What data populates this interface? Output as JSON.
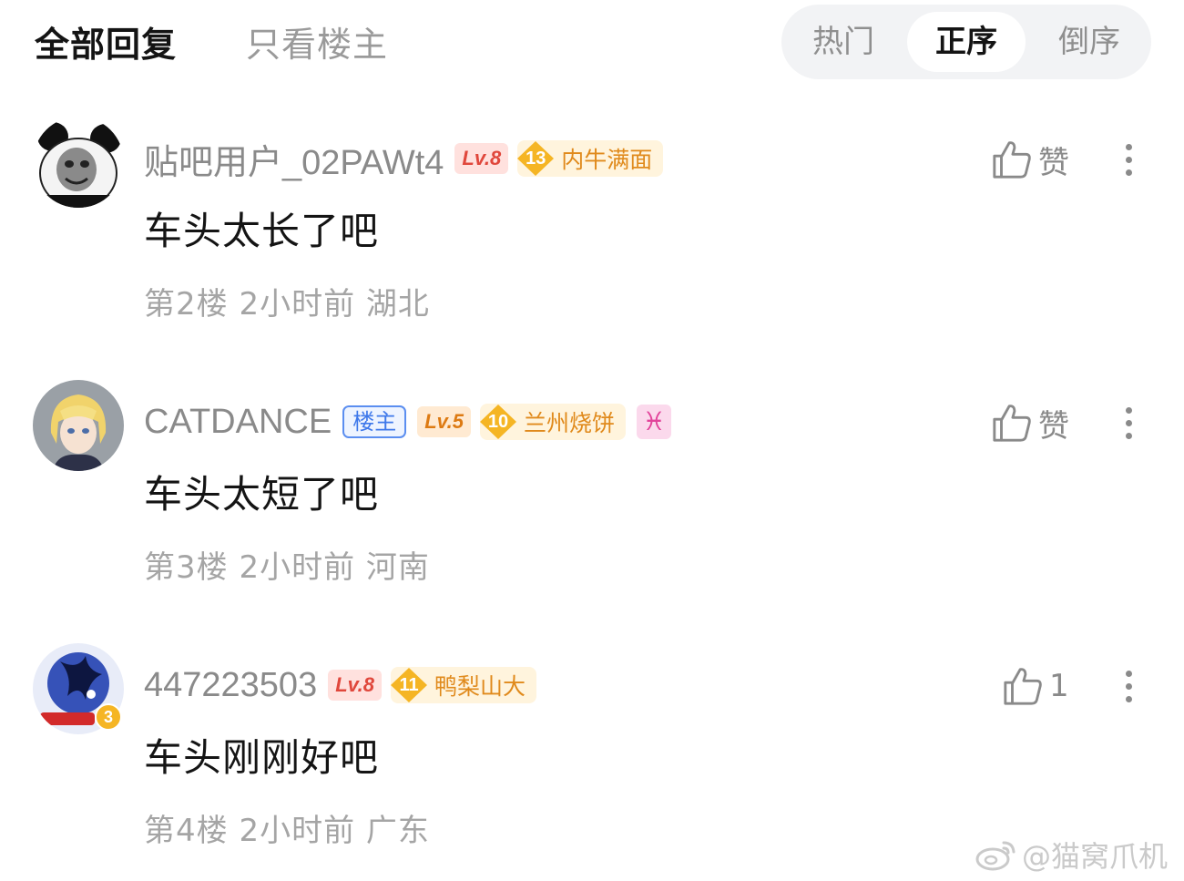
{
  "header": {
    "tab_all": "全部回复",
    "tab_owner_only": "只看楼主",
    "sort_hot": "热门",
    "sort_asc": "正序",
    "sort_desc": "倒序",
    "active_sort": "正序"
  },
  "comments": [
    {
      "username": "贴吧用户_02PAWt4",
      "level": "Lv.8",
      "honor_level": "13",
      "honor_title": "内牛满面",
      "content": "车头太长了吧",
      "floor": "第2楼",
      "time": "2小时前",
      "location": "湖北",
      "like_label": "赞",
      "avatar_icon": "panda-meme-avatar"
    },
    {
      "username": "CATDANCE",
      "owner_badge": "楼主",
      "level": "Lv.5",
      "honor_level": "10",
      "honor_title": "兰州烧饼",
      "zodiac_icon": "♓",
      "content": "车头太短了吧",
      "floor": "第3楼",
      "time": "2小时前",
      "location": "河南",
      "like_label": "赞",
      "avatar_icon": "anime-character-avatar"
    },
    {
      "username": "447223503",
      "level": "Lv.8",
      "honor_level": "11",
      "honor_title": "鸭梨山大",
      "content": "车头刚刚好吧",
      "floor": "第4楼",
      "time": "2小时前",
      "location": "广东",
      "like_label": "1",
      "avatar_badge": "3",
      "avatar_icon": "game-art-avatar"
    }
  ],
  "watermark": {
    "text": "@猫窝爪机",
    "icon": "weibo-logo-icon"
  },
  "colors": {
    "level_red_bg": "#ffe1de",
    "level_red_text": "#e0473c",
    "level_orange_bg": "#ffead2",
    "level_orange_text": "#dd7a12",
    "honor_gold": "#f5b524",
    "owner_badge_blue": "#3e78ea",
    "zodiac_pink": "#e2429a"
  }
}
